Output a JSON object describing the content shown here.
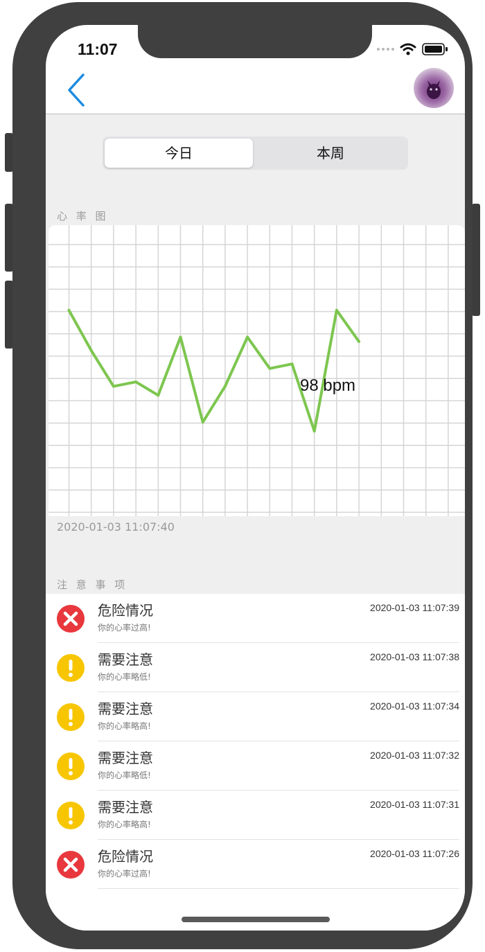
{
  "status_bar": {
    "time": "11:07"
  },
  "segmented_control": {
    "today": "今日",
    "week": "本周"
  },
  "heart_section": {
    "title": "心 率 图",
    "timestamp": "2020-01-03 11:07:40"
  },
  "chart_data": {
    "type": "line",
    "x": [
      1,
      2,
      3,
      4,
      5,
      6,
      7,
      8,
      9,
      10,
      11,
      12,
      13,
      14
    ],
    "values": [
      106,
      97,
      89,
      90,
      87,
      100,
      81,
      89,
      100,
      93,
      94,
      79,
      106,
      99
    ],
    "annotation": "98 bpm",
    "line_color": "#7dc64f",
    "grid": true,
    "ylim": [
      60,
      125
    ]
  },
  "notes_section": {
    "title": "注 意 事 项"
  },
  "alerts": [
    {
      "level": "danger",
      "icon": "x-circle-icon",
      "title": "危险情况",
      "desc": "你的心率过高!",
      "time": "2020-01-03 11:07:39"
    },
    {
      "level": "warning",
      "icon": "exclamation-circle-icon",
      "title": "需要注意",
      "desc": "你的心率略低!",
      "time": "2020-01-03 11:07:38"
    },
    {
      "level": "warning",
      "icon": "exclamation-circle-icon",
      "title": "需要注意",
      "desc": "你的心率略高!",
      "time": "2020-01-03 11:07:34"
    },
    {
      "level": "warning",
      "icon": "exclamation-circle-icon",
      "title": "需要注意",
      "desc": "你的心率略低!",
      "time": "2020-01-03 11:07:32"
    },
    {
      "level": "warning",
      "icon": "exclamation-circle-icon",
      "title": "需要注意",
      "desc": "你的心率略高!",
      "time": "2020-01-03 11:07:31"
    },
    {
      "level": "danger",
      "icon": "x-circle-icon",
      "title": "危险情况",
      "desc": "你的心率过高!",
      "time": "2020-01-03 11:07:26"
    }
  ],
  "colors": {
    "danger": "#e8383d",
    "warning": "#f7c600",
    "accent": "#1c8be0",
    "chart_line": "#7dc64f"
  }
}
